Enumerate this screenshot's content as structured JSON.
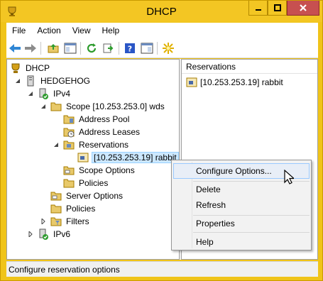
{
  "window": {
    "title": "DHCP"
  },
  "menu": [
    "File",
    "Action",
    "View",
    "Help"
  ],
  "toolbar": {
    "buttons": [
      "back-arrow-icon",
      "forward-arrow-icon",
      "up-folder-icon",
      "show-hide-tree-icon",
      "refresh-icon",
      "export-list-icon",
      "help-icon",
      "action-pane-icon",
      "new-star-icon"
    ]
  },
  "tree": {
    "root": "DHCP",
    "server": "HEDGEHOG",
    "ipv4": "IPv4",
    "scope": "Scope [10.253.253.0] wds",
    "address_pool": "Address Pool",
    "address_leases": "Address Leases",
    "reservations": "Reservations",
    "reservation_item": "[10.253.253.19] rabbit",
    "scope_options": "Scope Options",
    "scope_policies": "Policies",
    "server_options": "Server Options",
    "policies": "Policies",
    "filters": "Filters",
    "ipv6": "IPv6"
  },
  "results": {
    "header": "Reservations",
    "rows": [
      "[10.253.253.19] rabbit"
    ]
  },
  "context_menu": {
    "configure_options": "Configure Options...",
    "delete": "Delete",
    "refresh": "Refresh",
    "properties": "Properties",
    "help": "Help"
  },
  "status": {
    "text": "Configure reservation options"
  },
  "colors": {
    "window_frame": "#f3c623",
    "close_button": "#c75050",
    "selection": "#cce8ff",
    "menu_highlight": "#99c9ff"
  }
}
